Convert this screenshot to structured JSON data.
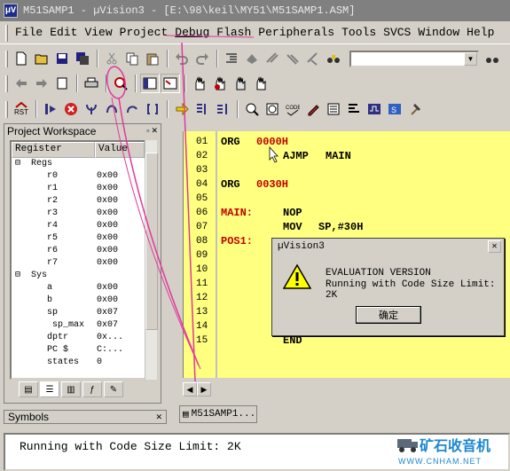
{
  "window": {
    "title": "M51SAMP1 - µVision3 - [E:\\98\\keil\\MY51\\M51SAMP1.ASM]"
  },
  "menu": {
    "items": [
      "File",
      "Edit",
      "View",
      "Project",
      "Debug",
      "Flash",
      "Peripherals",
      "Tools",
      "SVCS",
      "Window",
      "Help"
    ]
  },
  "toolbar": {
    "rst_label": "RST",
    "combo_value": ""
  },
  "workspace": {
    "title": "Project Workspace",
    "col_register": "Register",
    "col_value": "Value",
    "regs_group": "Regs",
    "sys_group": "Sys",
    "regs": [
      {
        "name": "r0",
        "value": "0x00"
      },
      {
        "name": "r1",
        "value": "0x00"
      },
      {
        "name": "r2",
        "value": "0x00"
      },
      {
        "name": "r3",
        "value": "0x00"
      },
      {
        "name": "r4",
        "value": "0x00"
      },
      {
        "name": "r5",
        "value": "0x00"
      },
      {
        "name": "r6",
        "value": "0x00"
      },
      {
        "name": "r7",
        "value": "0x00"
      }
    ],
    "sys": [
      {
        "name": "a",
        "value": "0x00"
      },
      {
        "name": "b",
        "value": "0x00"
      },
      {
        "name": "sp",
        "value": "0x07"
      },
      {
        "name": "sp_max",
        "value": "0x07"
      },
      {
        "name": "dptr",
        "value": "0x..."
      },
      {
        "name": "PC  $",
        "value": "C:..."
      },
      {
        "name": "states",
        "value": "0"
      }
    ]
  },
  "symbols": {
    "title": "Symbols"
  },
  "editor": {
    "file_tab": "M51SAMP1...",
    "line_numbers": [
      "01",
      "02",
      "03",
      "04",
      "05",
      "06",
      "07",
      "08",
      "09",
      "10",
      "11",
      "12",
      "13",
      "14",
      "15"
    ],
    "lines": [
      {
        "label": "",
        "op": "ORG",
        "arg": "0000H"
      },
      {
        "label": "",
        "op": "AJMP",
        "arg": "MAIN"
      },
      {
        "label": "",
        "op": "",
        "arg": ""
      },
      {
        "label": "",
        "op": "ORG",
        "arg": "0030H"
      },
      {
        "label": "",
        "op": "",
        "arg": ""
      },
      {
        "label": "MAIN:",
        "op": "NOP",
        "arg": ""
      },
      {
        "label": "",
        "op": "MOV",
        "arg": "SP,#30H"
      },
      {
        "label": "POS1:",
        "op": "",
        "arg": ""
      },
      {
        "label": "",
        "op": "",
        "arg": ""
      },
      {
        "label": "",
        "op": "",
        "arg": ""
      },
      {
        "label": "",
        "op": "",
        "arg": ""
      },
      {
        "label": "",
        "op": "",
        "arg": ""
      },
      {
        "label": "",
        "op": "",
        "arg": ""
      },
      {
        "label": "",
        "op": "",
        "arg": ""
      },
      {
        "label": "",
        "op": "END",
        "arg": ""
      }
    ]
  },
  "dialog": {
    "title": "µVision3",
    "line1": "EVALUATION VERSION",
    "line2": "Running with Code Size Limit: 2K",
    "ok_label": "确定"
  },
  "output": {
    "text": "Running with Code Size Limit: 2K"
  },
  "watermark": {
    "brand": "矿石收音机",
    "url": "WWW.CNHAM.NET"
  },
  "colors": {
    "editor_bg": "#ffff80",
    "label_red": "#c00000",
    "address_red": "#c00000",
    "annotation": "#e0389b"
  }
}
